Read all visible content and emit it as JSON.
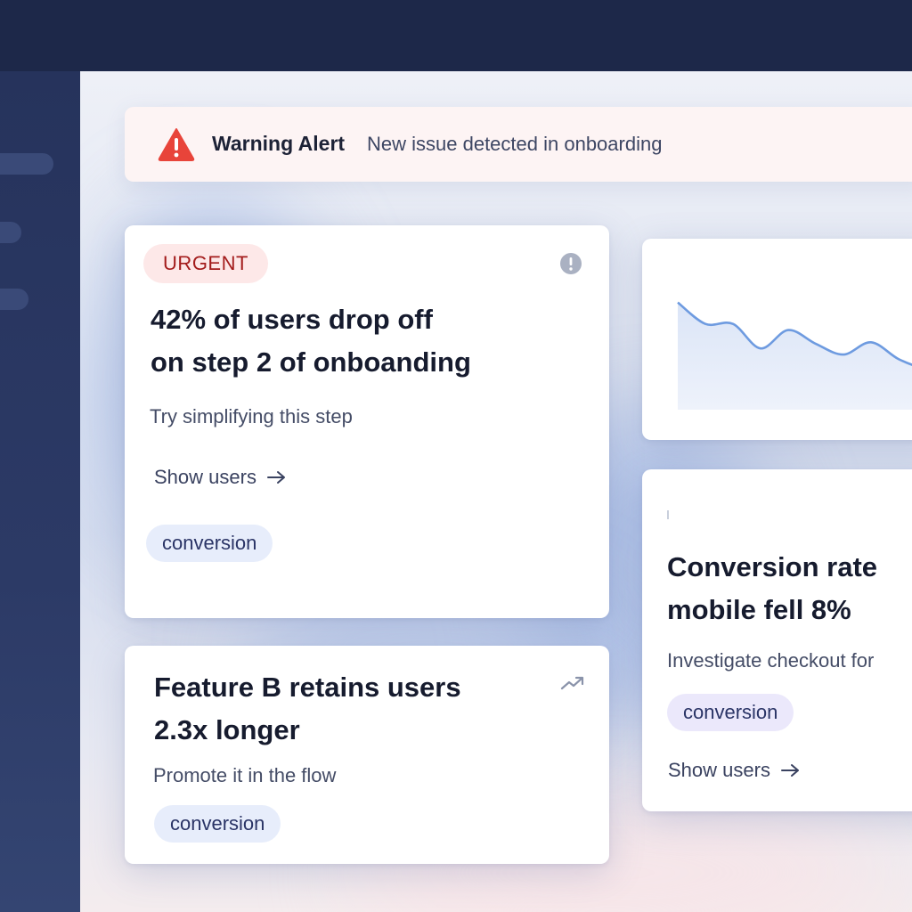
{
  "alert": {
    "icon": "warning-triangle-icon",
    "title": "Warning Alert",
    "message": "New issue detected in onboarding",
    "color": "#e8443a"
  },
  "cards": [
    {
      "badge": "URGENT",
      "info_icon": "info-circle-icon",
      "title_line1": "42% of users drop off",
      "title_line2": "on step 2 of onboanding",
      "subtitle": "Try simplifying this step",
      "action": "Show users",
      "action_icon": "arrow-right-icon",
      "tag": "conversion"
    },
    {
      "trend_icon": "trend-up-icon",
      "title_line1": "Feature B retains users",
      "title_line2": "2.3x longer",
      "subtitle": "Promote it in the flow",
      "tag": "conversion"
    },
    {
      "title_line1": "Conversion rate",
      "title_line2": "mobile fell 8%",
      "subtitle": "Investigate checkout for",
      "tag": "conversion",
      "action": "Show users",
      "action_icon": "arrow-right-icon"
    }
  ],
  "chart_data": {
    "type": "area",
    "x": [
      0,
      1,
      2,
      3,
      4,
      5,
      6,
      7,
      8,
      9,
      10
    ],
    "values": [
      70,
      56,
      56,
      40,
      52,
      43,
      36,
      44,
      33,
      26,
      20
    ],
    "ylim": [
      0,
      100
    ],
    "grid": false,
    "color": "#6e9be0"
  }
}
